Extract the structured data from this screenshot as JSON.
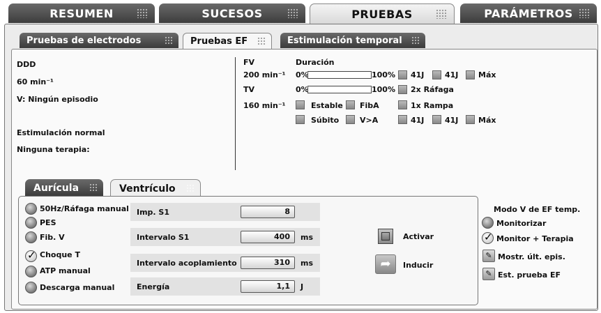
{
  "top_tabs": [
    {
      "label": "RESUMEN"
    },
    {
      "label": "SUCESOS"
    },
    {
      "label": "PRUEBAS"
    },
    {
      "label": "PARÁMETROS"
    }
  ],
  "sub_tabs": [
    {
      "label": "Pruebas de electrodos"
    },
    {
      "label": "Pruebas EF"
    },
    {
      "label": "Estimulación temporal"
    }
  ],
  "status": {
    "mode": "DDD",
    "rate": "60 min⁻¹",
    "episode": "V: Ningún episodio",
    "pacing": "Estimulación normal",
    "therapy": "Ninguna terapia:"
  },
  "zones": {
    "fv_label": "FV",
    "duration_label": "Duración",
    "fv_rate": "200 min⁻¹",
    "fv_bar_start": "0%",
    "fv_bar_end": "100%",
    "fv_bar_fill": 0,
    "fv_options": [
      "41J",
      "41J",
      "Máx"
    ],
    "tv_label": "TV",
    "tv_bar_start": "0%",
    "tv_bar_end": "100%",
    "tv_bar_fill": 0,
    "tv_burst": "2x Ráfaga",
    "tv_rate": "160 min⁻¹",
    "stable": "Estable",
    "afib": "FibA",
    "ramp": "1x Rampa",
    "sudden": "Súbito",
    "v_gt_a": "V>A",
    "tv_options": [
      "41J",
      "41J",
      "Máx"
    ]
  },
  "chamber_tabs": [
    {
      "label": "Aurícula"
    },
    {
      "label": "Ventrículo"
    }
  ],
  "induction_methods": [
    {
      "label": "50Hz/Ráfaga manual",
      "checked": false
    },
    {
      "label": "PES",
      "checked": false
    },
    {
      "label": "Fib. V",
      "checked": false
    },
    {
      "label": "Choque T",
      "checked": true
    },
    {
      "label": "ATP manual",
      "checked": false
    },
    {
      "label": "Descarga manual",
      "checked": false
    }
  ],
  "params": {
    "imp_s1_label": "Imp. S1",
    "imp_s1_value": "8",
    "interval_s1_label": "Intervalo S1",
    "interval_s1_value": "400",
    "interval_s1_unit": "ms",
    "coupling_label": "Intervalo acoplamiento",
    "coupling_value": "310",
    "coupling_unit": "ms",
    "energy_label": "Energía",
    "energy_value": "1,1",
    "energy_unit": "J"
  },
  "actions": {
    "activate": "Activar",
    "induce": "Inducir"
  },
  "temp_mode": {
    "title": "Modo V de EF temp.",
    "monitor": "Monitorizar",
    "monitor_checked": false,
    "monitor_therapy": "Monitor + Terapia",
    "monitor_therapy_checked": true,
    "last_episode": "Mostr. últ. epis.",
    "test_state": "Est. prueba EF"
  },
  "colors": {
    "tab_dark": "#4a4a4a",
    "panel_bg": "#ececec",
    "text": "#111111"
  }
}
